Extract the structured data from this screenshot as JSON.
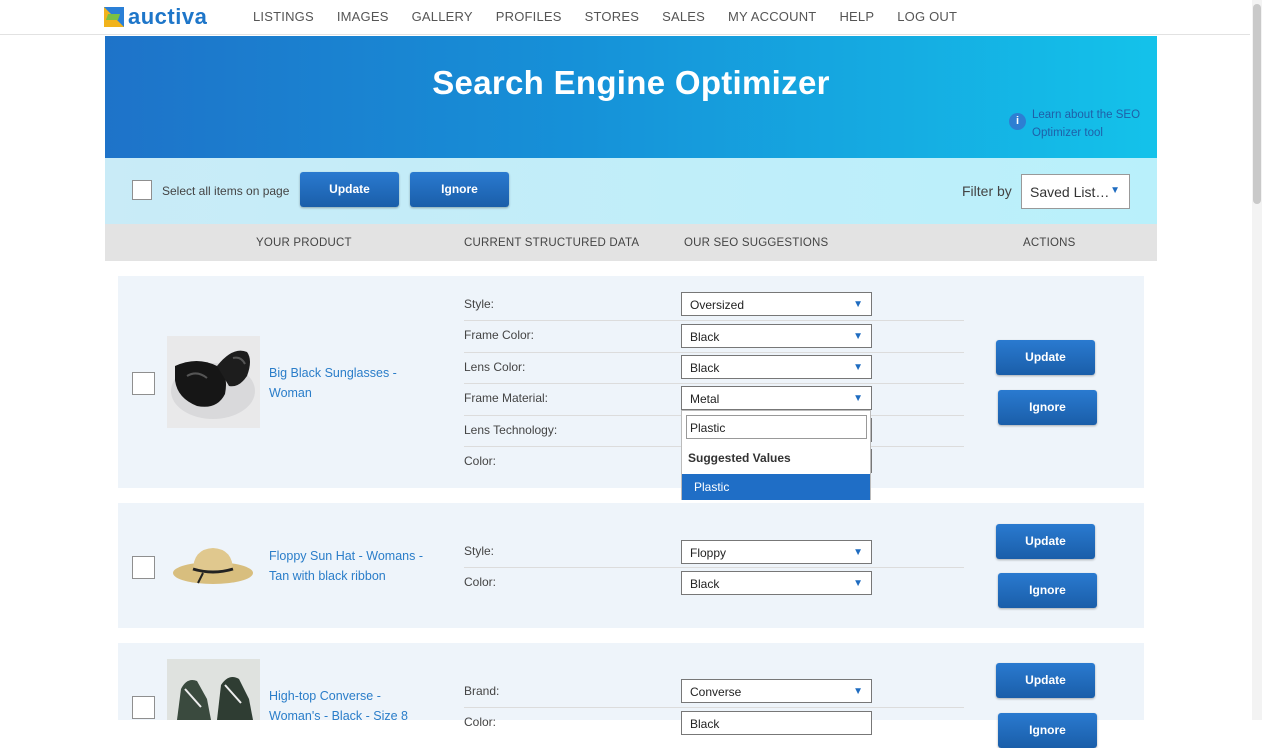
{
  "nav": {
    "logo": "auctiva",
    "links": [
      "LISTINGS",
      "IMAGES",
      "GALLERY",
      "PROFILES",
      "STORES",
      "SALES",
      "MY ACCOUNT",
      "HELP",
      "LOG OUT"
    ]
  },
  "hero": {
    "title": "Search Engine Optimizer",
    "learn_link": "Learn about the SEO Optimizer tool",
    "info_icon": "i"
  },
  "toolbar": {
    "select_all_label": "Select all items on page",
    "update_label": "Update",
    "ignore_label": "Ignore",
    "filter_label": "Filter by",
    "filter_value": "Saved List…"
  },
  "columns": {
    "product": "YOUR PRODUCT",
    "current": "CURRENT STRUCTURED DATA",
    "suggestions": "OUR SEO SUGGESTIONS",
    "actions": "ACTIONS"
  },
  "products": [
    {
      "title": "Big Black Sunglasses - Woman",
      "fields": [
        {
          "label": "Style:",
          "value": "Oversized"
        },
        {
          "label": "Frame Color:",
          "value": "Black"
        },
        {
          "label": "Lens Color:",
          "value": "Black"
        },
        {
          "label": "Frame Material:",
          "value": "Metal"
        },
        {
          "label": "Lens Technology:",
          "value": ""
        },
        {
          "label": "Color:",
          "value": ""
        }
      ],
      "update_label": "Update",
      "ignore_label": "Ignore"
    },
    {
      "title": "Floppy Sun Hat - Womans - Tan with black ribbon",
      "fields": [
        {
          "label": "Style:",
          "value": "Floppy"
        },
        {
          "label": "Color:",
          "value": "Black"
        }
      ],
      "update_label": "Update",
      "ignore_label": "Ignore"
    },
    {
      "title": "High-top Converse - Woman's - Black - Size 8",
      "fields": [
        {
          "label": "Brand:",
          "value": "Converse"
        },
        {
          "label": "Color:",
          "value": "Black"
        }
      ],
      "update_label": "Update",
      "ignore_label": "Ignore"
    }
  ],
  "dropdown": {
    "input_value": "Plastic",
    "header": "Suggested Values",
    "options": [
      "Plastic"
    ]
  },
  "colors": {
    "accent": "#1f6ec6",
    "link": "#2a7dc9",
    "hero_start": "#1e73c9",
    "hero_end": "#14c2ea"
  }
}
